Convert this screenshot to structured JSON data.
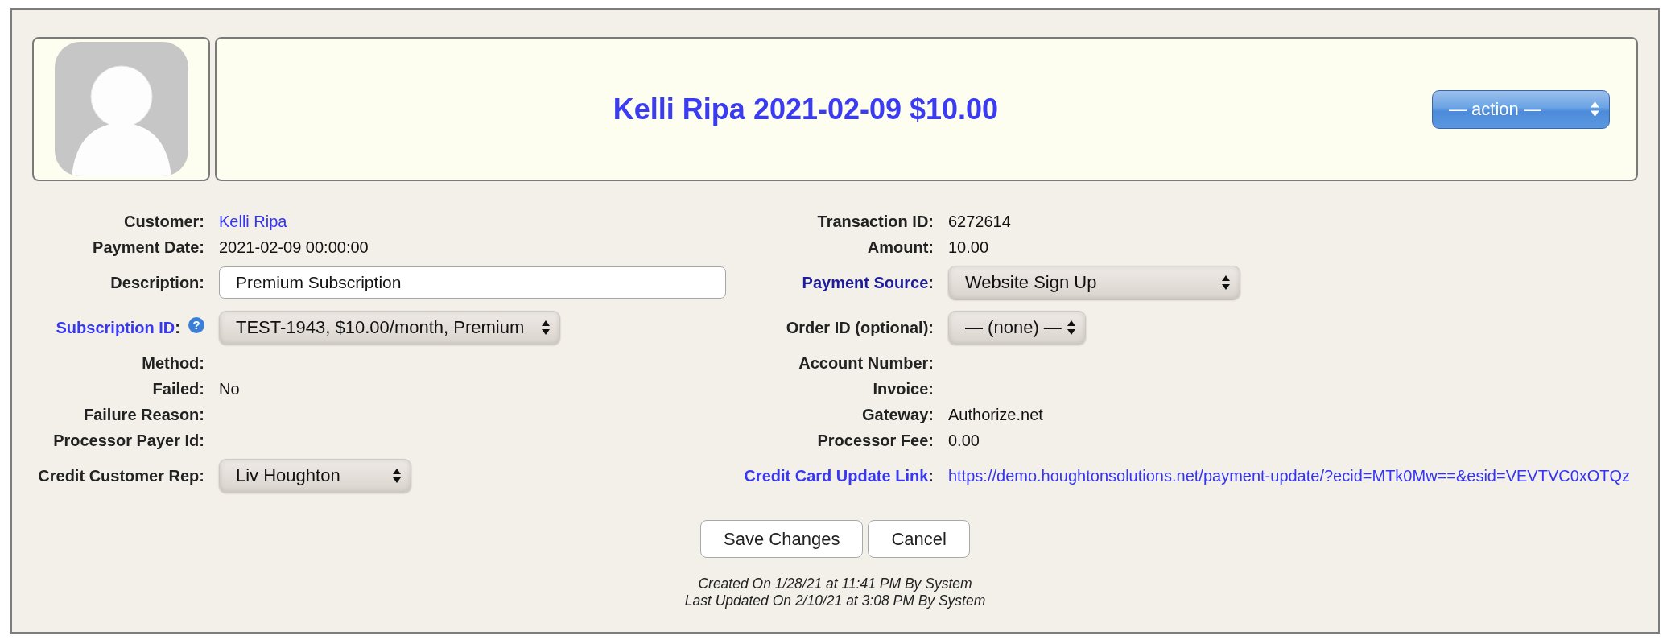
{
  "header": {
    "title": "Kelli Ripa 2021-02-09 $10.00",
    "action": "— action —"
  },
  "rows": [
    {
      "left": {
        "label": "Customer:",
        "kind": "link",
        "value": "Kelli Ripa"
      },
      "right": {
        "label": "Transaction ID:",
        "kind": "text",
        "value": "6272614"
      }
    },
    {
      "left": {
        "label": "Payment Date:",
        "kind": "text",
        "value": "2021-02-09 00:00:00"
      },
      "right": {
        "label": "Amount:",
        "kind": "text",
        "value": "10.00"
      }
    },
    {
      "left": {
        "label": "Description:",
        "kind": "input",
        "value": "Premium Subscription"
      },
      "right": {
        "label_link": "Payment Source",
        "label_suffix": ":",
        "visited": true,
        "kind": "select",
        "value": "Website Sign Up"
      }
    },
    {
      "left": {
        "label_link": "Subscription ID",
        "label_suffix": ":",
        "visited": false,
        "help": "?",
        "kind": "select",
        "value": "TEST-1943, $10.00/month, Premium"
      },
      "right": {
        "label": "Order ID (optional):",
        "kind": "select",
        "value": "— (none) —"
      }
    },
    {
      "left": {
        "label": "Method:",
        "kind": "text"
      },
      "right": {
        "label": "Account Number:",
        "kind": "text"
      }
    },
    {
      "left": {
        "label": "Failed:",
        "kind": "text",
        "value": "No"
      },
      "right": {
        "label": "Invoice:",
        "kind": "text"
      }
    },
    {
      "left": {
        "label": "Failure Reason:",
        "kind": "text"
      },
      "right": {
        "label": "Gateway:",
        "kind": "text",
        "value": "Authorize.net"
      }
    },
    {
      "left": {
        "label": "Processor Payer Id:",
        "kind": "text"
      },
      "right": {
        "label": "Processor Fee:",
        "kind": "text",
        "value": "0.00"
      }
    },
    {
      "left": {
        "label": "Credit Customer Rep:",
        "kind": "select",
        "value": "Liv Houghton"
      },
      "right": {
        "label_link": "Credit Card Update Link",
        "label_suffix": ":",
        "visited": false,
        "kind": "link",
        "value": "https://demo.houghtonsolutions.net/payment-update/?ecid=MTk0Mw==&esid=VEVTVC0xOTQz"
      }
    }
  ],
  "buttons": [
    "Save Changes",
    "Cancel"
  ],
  "footer": [
    "Created On 1/28/21 at 11:41 PM By System",
    "Last Updated On 2/10/21 at 3:08 PM By System"
  ]
}
